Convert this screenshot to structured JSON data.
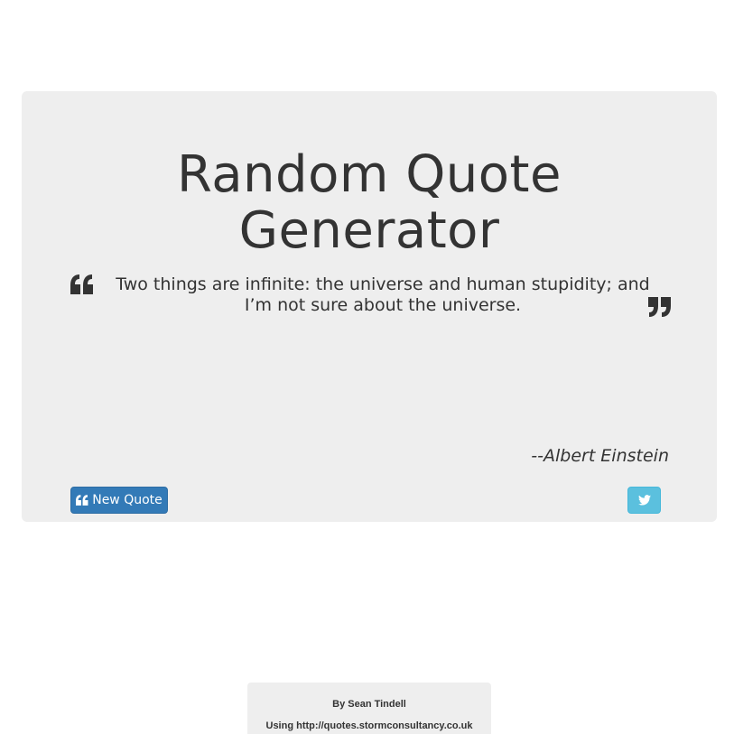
{
  "card": {
    "title_line1": "Random Quote",
    "title_line2": "Generator",
    "quote": "Two things are infinite: the universe and human stupidity; and I’m not sure about the universe.",
    "author": "--Albert Einstein",
    "new_quote_label": "New Quote",
    "icons": {
      "quote_open": "quote-left-icon",
      "quote_close": "quote-right-icon",
      "tweet": "twitter-icon"
    }
  },
  "footer": {
    "by_line": "By Sean Tindell",
    "using_line": "Using http://quotes.stormconsultancy.co.uk"
  },
  "colors": {
    "card_background": "#eeeeee",
    "text": "#333333",
    "primary_button": "#337ab7",
    "tweet_button": "#5bc0de"
  }
}
